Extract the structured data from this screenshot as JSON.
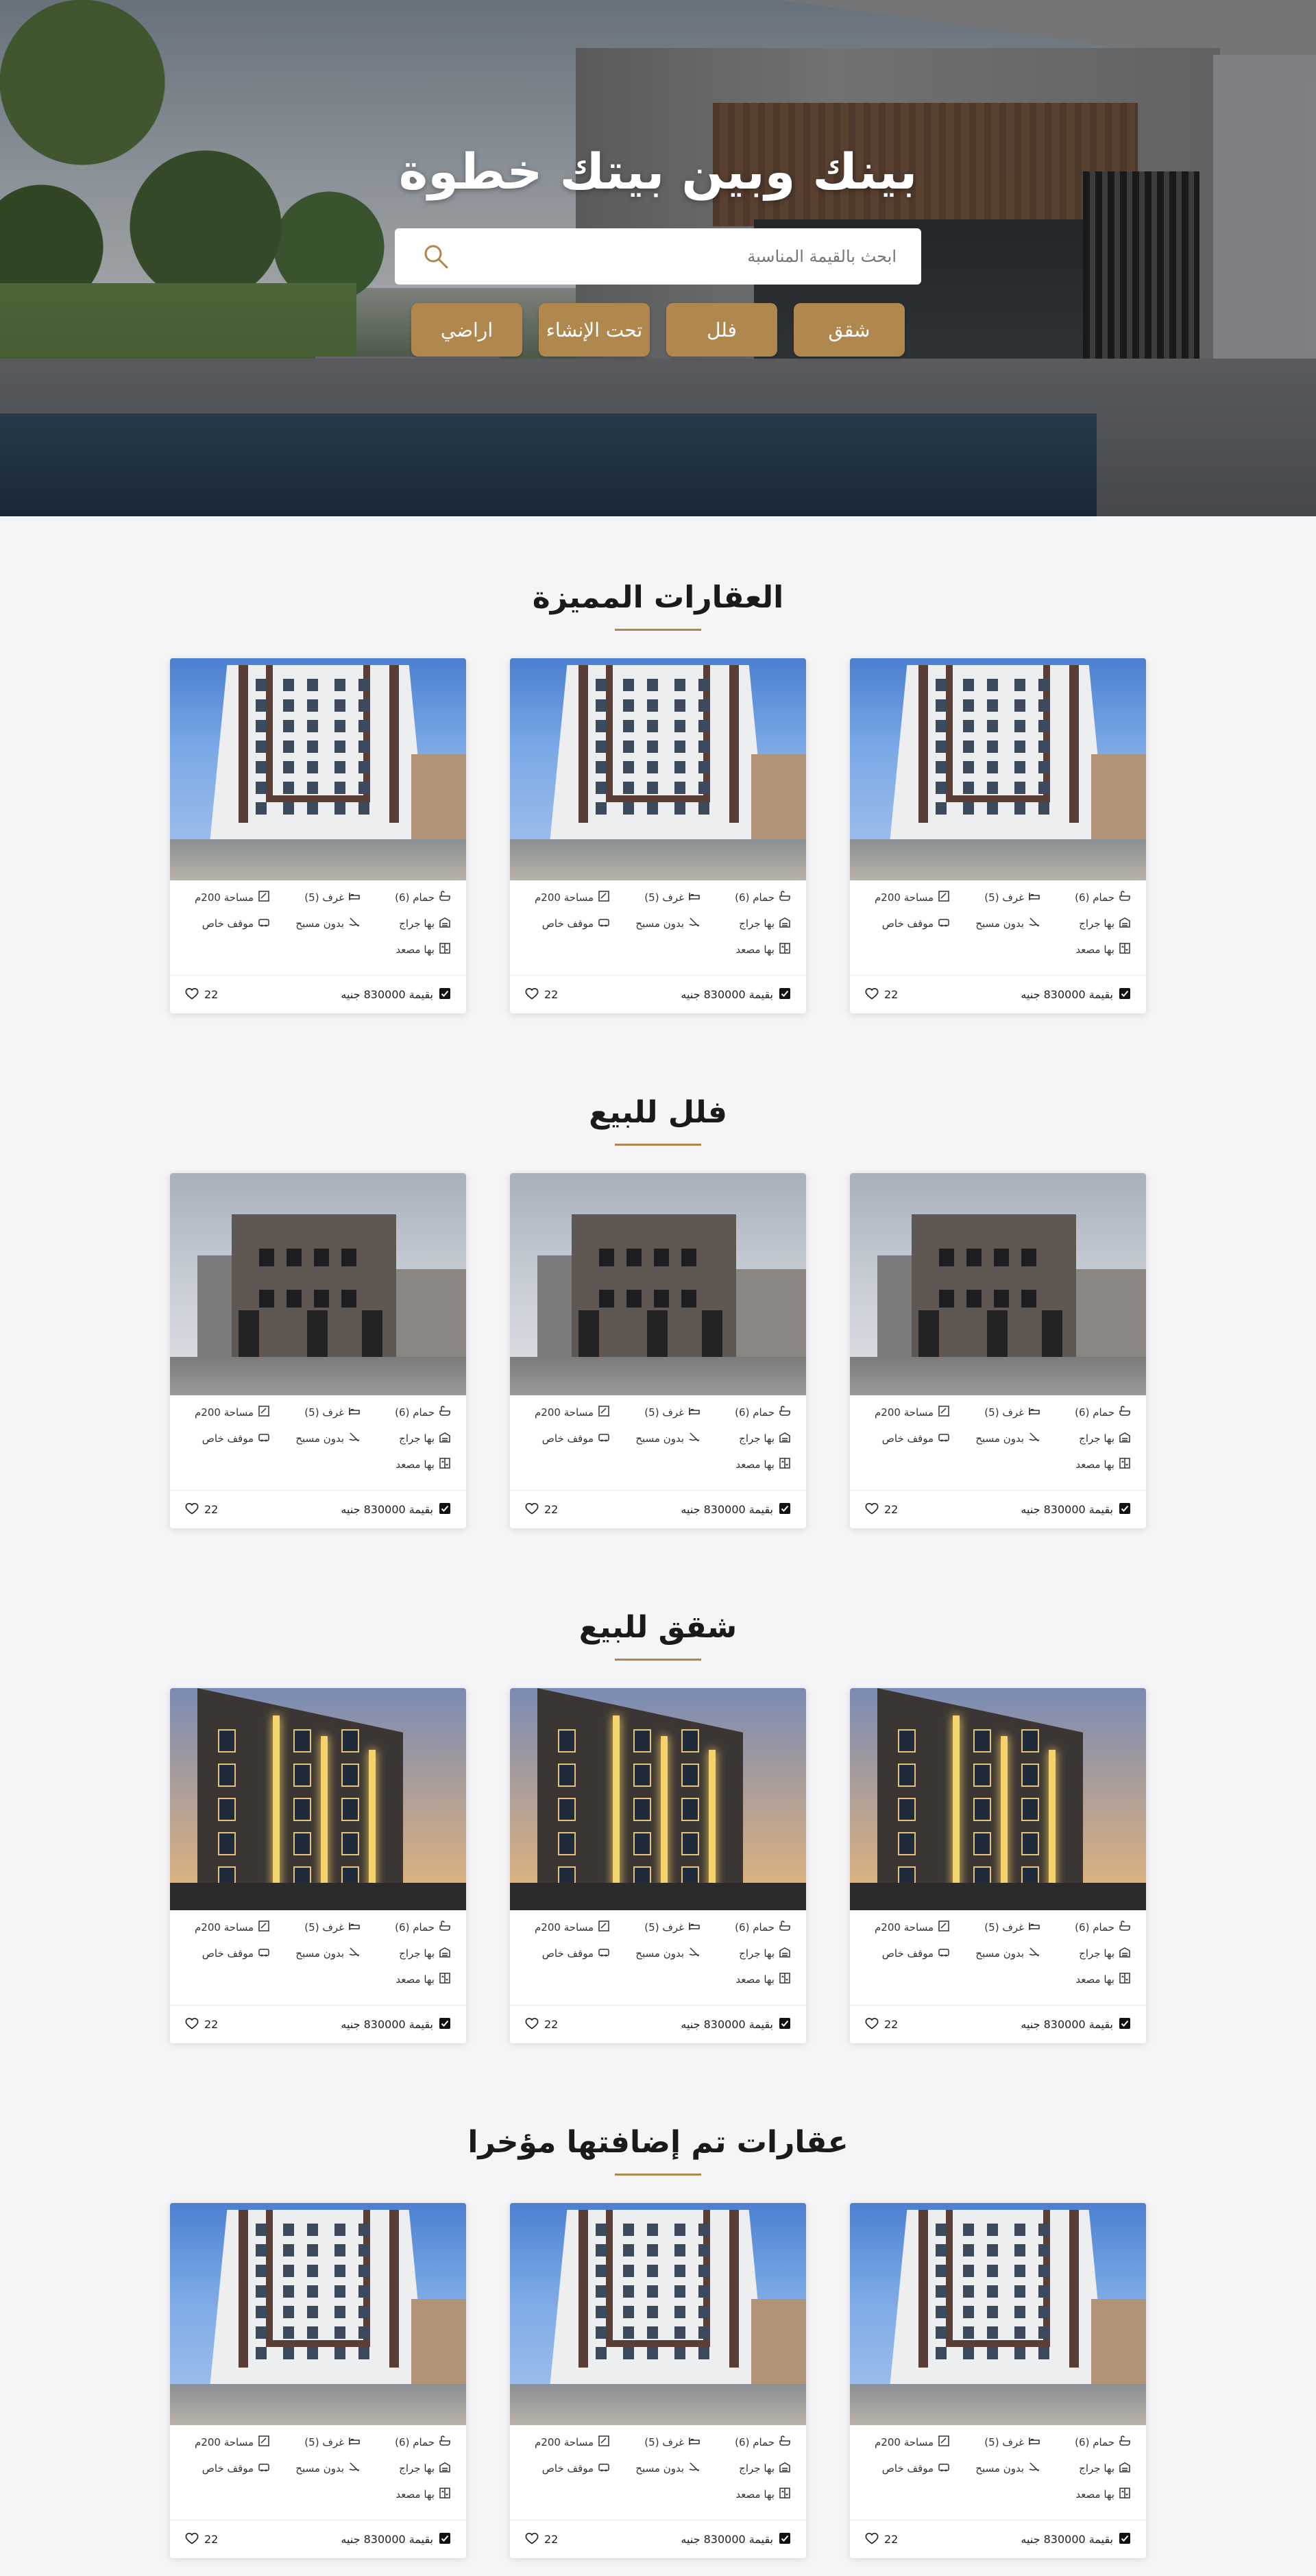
{
  "hero": {
    "title": "بينك وبين بيتك خطوة",
    "search_placeholder": "ابحث بالقيمة المناسبة",
    "filters": [
      "شقق",
      "فلل",
      "تحت الإنشاء",
      "اراضي"
    ]
  },
  "card_template": {
    "bathrooms": "حمام (6)",
    "rooms": "غرف (5)",
    "area": "مساحة 200م",
    "garage": "بها جراج",
    "pool": "بدون مسبح",
    "parking": "موقف خاص",
    "elevator": "بها مصعد",
    "price": "بقيمة 830000 جنيه",
    "likes": "22"
  },
  "sections": [
    {
      "title": "العقارات المميزة",
      "image": "white"
    },
    {
      "title": "فلل للبيع",
      "image": "brown"
    },
    {
      "title": "شقق للبيع",
      "image": "night"
    },
    {
      "title": "عقارات تم إضافتها مؤخرا",
      "image": "white"
    }
  ],
  "colors": {
    "accent": "#b0874c",
    "page_bg": "#f5f5f7"
  },
  "icons": [
    "search-icon",
    "bath-icon",
    "bed-icon",
    "area-icon",
    "garage-icon",
    "pool-icon",
    "parking-icon",
    "elevator-icon",
    "check-icon",
    "heart-icon"
  ]
}
